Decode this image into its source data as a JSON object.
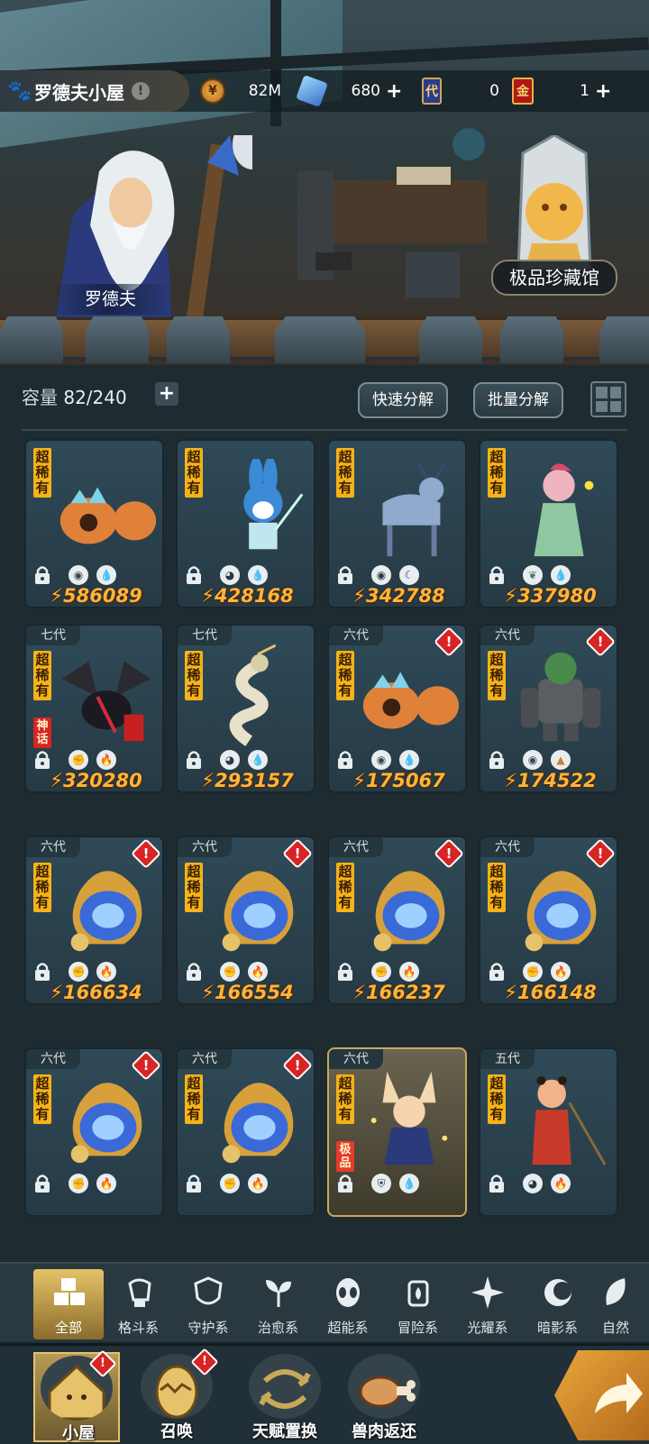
{
  "header": {
    "title": "罗德夫小屋",
    "title_icon": "paw-icon",
    "resources": [
      {
        "icon": "gold-coin-icon",
        "value": "82M",
        "has_plus": false
      },
      {
        "icon": "crystal-icon",
        "value": "680",
        "has_plus": true
      },
      {
        "icon": "generation-card-icon",
        "icon_text": "代",
        "value": "0",
        "has_plus": false
      },
      {
        "icon": "gold-ticket-icon",
        "icon_text": "金",
        "value": "1",
        "has_plus": true
      }
    ]
  },
  "scene": {
    "npc_name": "罗德夫",
    "museum_label": "极品珍藏馆"
  },
  "storage": {
    "capacity_label": "容量",
    "capacity_value": "82/240",
    "quick_decompose": "快速分解",
    "batch_decompose": "批量分解"
  },
  "cards": [
    {
      "gen": "",
      "rarity": "超稀有",
      "alert": false,
      "power": "586089",
      "elements": [
        "armor",
        "water"
      ],
      "creature": "crab"
    },
    {
      "gen": "",
      "rarity": "超稀有",
      "alert": false,
      "power": "428168",
      "elements": [
        "alien",
        "water"
      ],
      "creature": "rabbit"
    },
    {
      "gen": "",
      "rarity": "超稀有",
      "alert": false,
      "power": "342788",
      "elements": [
        "eye",
        "shadow"
      ],
      "creature": "deer"
    },
    {
      "gen": "",
      "rarity": "超稀有",
      "alert": false,
      "power": "337980",
      "elements": [
        "leaf",
        "water"
      ],
      "creature": "girl"
    },
    {
      "gen": "七代",
      "rarity": "超稀有",
      "alert": false,
      "power": "320280",
      "elements": [
        "fist",
        "fire"
      ],
      "creature": "dragon",
      "tag": "神话"
    },
    {
      "gen": "七代",
      "rarity": "超稀有",
      "alert": false,
      "power": "293157",
      "elements": [
        "alien",
        "water"
      ],
      "creature": "serpent"
    },
    {
      "gen": "六代",
      "rarity": "超稀有",
      "alert": true,
      "power": "175067",
      "elements": [
        "armor",
        "water"
      ],
      "creature": "crab"
    },
    {
      "gen": "六代",
      "rarity": "超稀有",
      "alert": true,
      "power": "174522",
      "elements": [
        "armor",
        "earth"
      ],
      "creature": "golem"
    },
    {
      "gen": "六代",
      "rarity": "超稀有",
      "alert": true,
      "power": "166634",
      "elements": [
        "fist",
        "fire"
      ],
      "creature": "blueflame"
    },
    {
      "gen": "六代",
      "rarity": "超稀有",
      "alert": true,
      "power": "166554",
      "elements": [
        "fist",
        "fire"
      ],
      "creature": "blueflame"
    },
    {
      "gen": "六代",
      "rarity": "超稀有",
      "alert": true,
      "power": "166237",
      "elements": [
        "fist",
        "fire"
      ],
      "creature": "blueflame"
    },
    {
      "gen": "六代",
      "rarity": "超稀有",
      "alert": true,
      "power": "166148",
      "elements": [
        "fist",
        "fire"
      ],
      "creature": "blueflame"
    },
    {
      "gen": "六代",
      "rarity": "超稀有",
      "alert": true,
      "power": "",
      "elements": [
        "fist",
        "fire"
      ],
      "creature": "blueflame"
    },
    {
      "gen": "六代",
      "rarity": "超稀有",
      "alert": true,
      "power": "",
      "elements": [
        "fist",
        "fire"
      ],
      "creature": "blueflame"
    },
    {
      "gen": "六代",
      "rarity": "超稀有",
      "alert": false,
      "power": "",
      "elements": [
        "shield",
        "water"
      ],
      "creature": "foxgirl",
      "tag": "极品",
      "special": true
    },
    {
      "gen": "五代",
      "rarity": "超稀有",
      "alert": false,
      "power": "",
      "elements": [
        "alien",
        "fire"
      ],
      "creature": "warrior"
    }
  ],
  "filters": [
    {
      "label": "全部",
      "icon": "all-blocks-icon",
      "active": true
    },
    {
      "label": "格斗系",
      "icon": "fist-icon"
    },
    {
      "label": "守护系",
      "icon": "shield-icon"
    },
    {
      "label": "治愈系",
      "icon": "sprout-icon"
    },
    {
      "label": "超能系",
      "icon": "alien-icon"
    },
    {
      "label": "冒险系",
      "icon": "lantern-icon"
    },
    {
      "label": "光耀系",
      "icon": "star-compass-icon"
    },
    {
      "label": "暗影系",
      "icon": "eclipse-icon"
    },
    {
      "label": "自然",
      "icon": "leaf-icon"
    }
  ],
  "nav": [
    {
      "label": "小屋",
      "icon": "house-icon",
      "active": true,
      "badge": true
    },
    {
      "label": "召唤",
      "icon": "egg-icon",
      "badge": true
    },
    {
      "label": "天赋置换",
      "icon": "swap-icon",
      "badge": false
    },
    {
      "label": "兽肉返还",
      "icon": "meat-icon",
      "badge": false
    }
  ],
  "nav_arrow_icon": "share-arrow-icon",
  "colors": {
    "rarity_badge": "#f3b319",
    "power_text": "#ffb43a",
    "alert_red": "#d82424",
    "active_gold": "#e6c267"
  }
}
